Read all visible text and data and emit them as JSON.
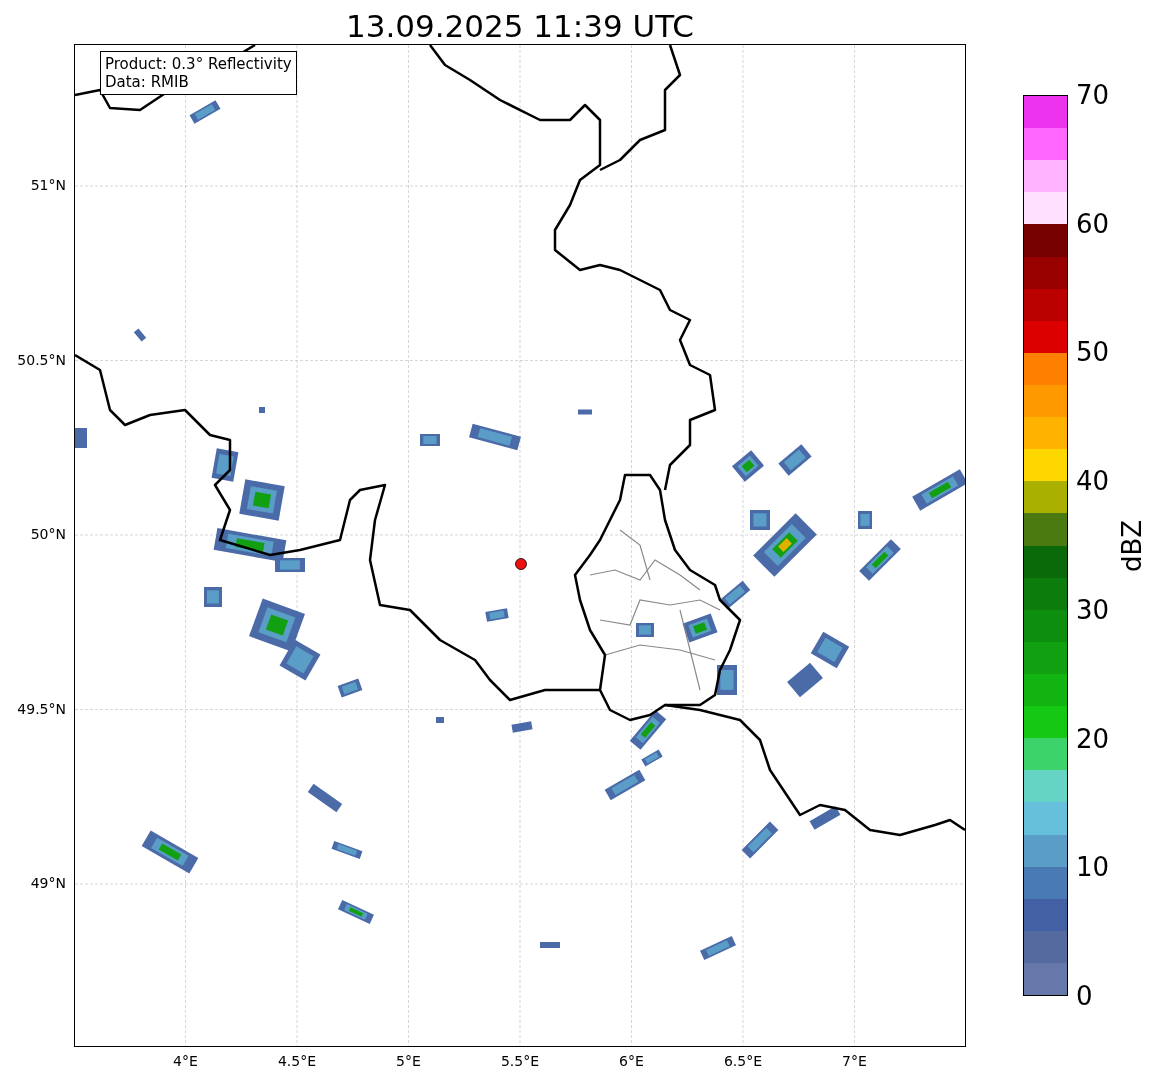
{
  "title": "13.09.2025 11:39 UTC",
  "info_box": [
    "Product: 0.3° Reflectivity",
    "Data: RMIB"
  ],
  "map": {
    "lat_labels": [
      "51°N",
      "50.5°N",
      "50°N",
      "49.5°N",
      "49°N"
    ],
    "lon_labels": [
      "4°E",
      "4.5°E",
      "5°E",
      "5.5°E",
      "6°E",
      "6.5°E",
      "7°E"
    ]
  },
  "colorbar": {
    "label": "dBZ",
    "ticks": [
      "70",
      "60",
      "50",
      "40",
      "30",
      "20",
      "10",
      "0"
    ],
    "bands": [
      {
        "color": "#6677aa"
      },
      {
        "color": "#556a9f"
      },
      {
        "color": "#4460a4"
      },
      {
        "color": "#4a7ab4"
      },
      {
        "color": "#5a9ec8"
      },
      {
        "color": "#66c0dc"
      },
      {
        "color": "#66d4c4"
      },
      {
        "color": "#3cd46a"
      },
      {
        "color": "#14c814"
      },
      {
        "color": "#12b412"
      },
      {
        "color": "#10a010"
      },
      {
        "color": "#0e8e0e"
      },
      {
        "color": "#0c7c0c"
      },
      {
        "color": "#0a6a0a"
      },
      {
        "color": "#4a7a10"
      },
      {
        "color": "#aab000"
      },
      {
        "color": "#ffd700"
      },
      {
        "color": "#ffb300"
      },
      {
        "color": "#ff9900"
      },
      {
        "color": "#ff7f00"
      },
      {
        "color": "#dd0000"
      },
      {
        "color": "#bb0000"
      },
      {
        "color": "#990000"
      },
      {
        "color": "#770000"
      },
      {
        "color": "#ffe0ff"
      },
      {
        "color": "#ffb3ff"
      },
      {
        "color": "#ff66ff"
      },
      {
        "color": "#ee33ee"
      }
    ]
  }
}
